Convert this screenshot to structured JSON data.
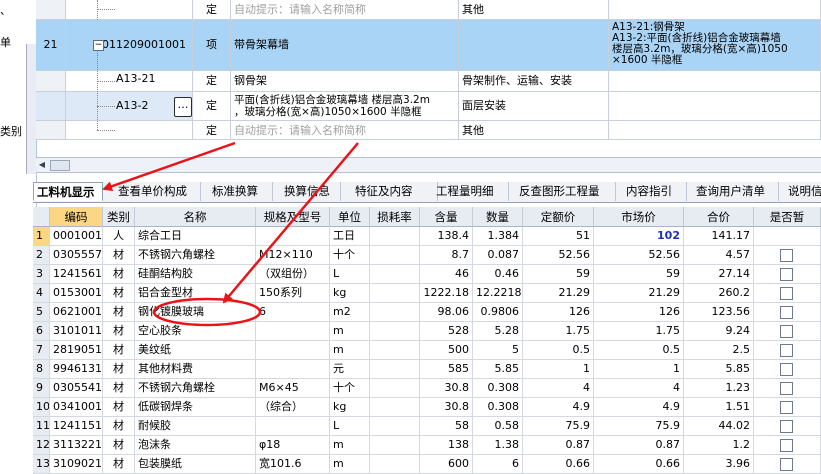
{
  "left_strip": {
    "text_1": "、",
    "text_2": "单",
    "text_3": "类别"
  },
  "upper_rows": [
    {
      "num": "",
      "code": "",
      "type": "定",
      "name": "自动提示：请输入名称简称",
      "name_hint": true,
      "work": "其他",
      "feature": ""
    },
    {
      "num": "21",
      "code": "011209001001",
      "type": "项",
      "name": "带骨架幕墙",
      "name_hint": false,
      "work": "",
      "feature_lines": [
        "A13-21:钢骨架",
        "A13-2:平面(含折线)铝合金玻璃幕墙",
        "楼层高3.2m，玻璃分格(宽×高)1050",
        "×1600 半隐框"
      ]
    },
    {
      "num": "",
      "code": "A13-21",
      "type": "定",
      "name": "钢骨架",
      "name_hint": false,
      "work": "骨架制作、运输、安装",
      "feature": ""
    },
    {
      "num": "",
      "code": "A13-2",
      "type": "定",
      "name_lines": [
        "平面(含折线)铝合金玻璃幕墙 楼层高3.2m",
        "，玻璃分格(宽×高)1050×1600 半隐框"
      ],
      "work": "面层安装",
      "feature": ""
    },
    {
      "num": "",
      "code": "",
      "type": "定",
      "name": "自动提示：请输入名称简称",
      "name_hint": true,
      "work": "其他",
      "feature": ""
    }
  ],
  "ellipsis_label": "…",
  "tree_toggle": "−",
  "tabs": [
    {
      "label": "工料机显示",
      "active": true
    },
    {
      "label": "查看单价构成"
    },
    {
      "label": "标准换算"
    },
    {
      "label": "换算信息"
    },
    {
      "label": "特征及内容"
    },
    {
      "label": "工程量明细"
    },
    {
      "label": "反查图形工程量"
    },
    {
      "label": "内容指引"
    },
    {
      "label": "查询用户清单"
    },
    {
      "label": "说明信"
    }
  ],
  "columns": [
    "",
    "编码",
    "类别",
    "名称",
    "规格及型号",
    "单位",
    "损耗率",
    "含量",
    "数量",
    "定额价",
    "市场价",
    "合价",
    "是否暂"
  ],
  "rows": [
    {
      "n": "1",
      "code": "0001001",
      "cat": "人",
      "name": "综合工日",
      "spec": "",
      "unit": "工日",
      "loss": "",
      "content": "138.4",
      "qty": "1.384",
      "quota": "51",
      "market": "102",
      "total": "141.17",
      "check": false
    },
    {
      "n": "2",
      "code": "0305557",
      "cat": "材",
      "name": "不锈钢六角螺栓",
      "spec": "M12×110",
      "unit": "十个",
      "loss": "",
      "content": "8.7",
      "qty": "0.087",
      "quota": "52.56",
      "market": "52.56",
      "total": "4.57",
      "check": true
    },
    {
      "n": "3",
      "code": "1241561",
      "cat": "材",
      "name": "硅酮结构胶",
      "spec": "（双组份）",
      "unit": "L",
      "loss": "",
      "content": "46",
      "qty": "0.46",
      "quota": "59",
      "market": "59",
      "total": "27.14",
      "check": true
    },
    {
      "n": "4",
      "code": "0153001",
      "cat": "材",
      "name": "铝合金型材",
      "spec": "150系列",
      "unit": "kg",
      "loss": "",
      "content": "1222.18",
      "qty": "12.2218",
      "quota": "21.29",
      "market": "21.29",
      "total": "260.2",
      "check": true
    },
    {
      "n": "5",
      "code": "0621001",
      "cat": "材",
      "name": "钢化镀膜玻璃",
      "spec": "6",
      "unit": "m2",
      "loss": "",
      "content": "98.06",
      "qty": "0.9806",
      "quota": "126",
      "market": "126",
      "total": "123.56",
      "check": true
    },
    {
      "n": "6",
      "code": "3101011",
      "cat": "材",
      "name": "空心胶条",
      "spec": "",
      "unit": "m",
      "loss": "",
      "content": "528",
      "qty": "5.28",
      "quota": "1.75",
      "market": "1.75",
      "total": "9.24",
      "check": true
    },
    {
      "n": "7",
      "code": "2819051",
      "cat": "材",
      "name": "美纹纸",
      "spec": "",
      "unit": "m",
      "loss": "",
      "content": "500",
      "qty": "5",
      "quota": "0.5",
      "market": "0.5",
      "total": "2.5",
      "check": true
    },
    {
      "n": "8",
      "code": "9946131",
      "cat": "材",
      "name": "其他材料费",
      "spec": "",
      "unit": "元",
      "loss": "",
      "content": "585",
      "qty": "5.85",
      "quota": "1",
      "market": "1",
      "total": "5.85",
      "check": true
    },
    {
      "n": "9",
      "code": "0305541",
      "cat": "材",
      "name": "不锈钢六角螺栓",
      "spec": "M6×45",
      "unit": "十个",
      "loss": "",
      "content": "30.8",
      "qty": "0.308",
      "quota": "4",
      "market": "4",
      "total": "1.23",
      "check": true
    },
    {
      "n": "10",
      "code": "0341001",
      "cat": "材",
      "name": "低碳钢焊条",
      "spec": "（综合）",
      "unit": "kg",
      "loss": "",
      "content": "30.8",
      "qty": "0.308",
      "quota": "4.9",
      "market": "4.9",
      "total": "1.51",
      "check": true
    },
    {
      "n": "11",
      "code": "1241151",
      "cat": "材",
      "name": "耐候胶",
      "spec": "",
      "unit": "L",
      "loss": "",
      "content": "58",
      "qty": "0.58",
      "quota": "75.9",
      "market": "75.9",
      "total": "44.02",
      "check": true
    },
    {
      "n": "12",
      "code": "3113221",
      "cat": "材",
      "name": "泡沫条",
      "spec": "φ18",
      "unit": "m",
      "loss": "",
      "content": "138",
      "qty": "1.38",
      "quota": "0.87",
      "market": "0.87",
      "total": "1.2",
      "check": true
    },
    {
      "n": "13",
      "code": "3109021",
      "cat": "材",
      "name": "包装膜纸",
      "spec": "宽101.6",
      "unit": "m",
      "loss": "",
      "content": "600",
      "qty": "6",
      "quota": "0.66",
      "market": "0.66",
      "total": "3.96",
      "check": true
    }
  ],
  "colors": {
    "selected_row": "#a9d4f5",
    "header_highlight": "#fbd784",
    "annotation": "#e8141a",
    "market_price_highlight": "#1d2fb5"
  }
}
